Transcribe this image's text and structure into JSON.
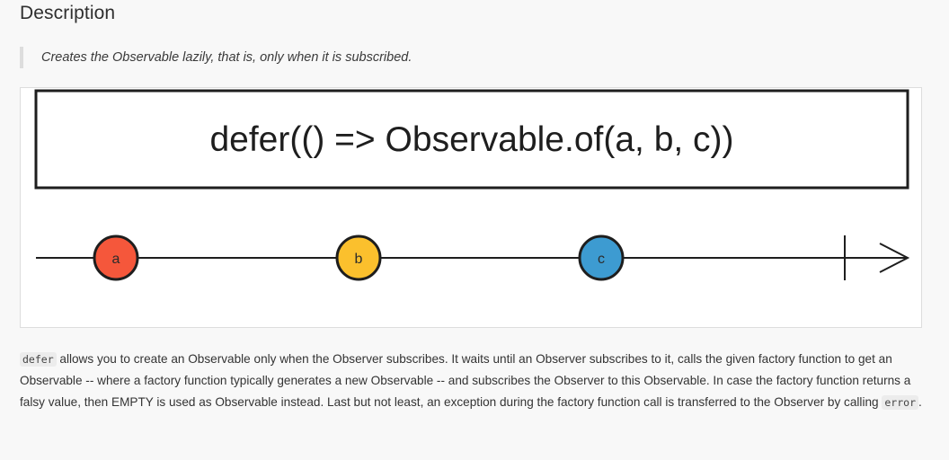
{
  "section": {
    "title": "Description"
  },
  "summary": {
    "text": "Creates the Observable lazily, that is, only when it is subscribed."
  },
  "diagram": {
    "operator_label": "defer(() => Observable.of(a, b, c))",
    "marbles": [
      {
        "label": "a",
        "color": "#f5573b"
      },
      {
        "label": "b",
        "color": "#fbc02d"
      },
      {
        "label": "c",
        "color": "#3d9bd1"
      }
    ],
    "colors": {
      "line": "#1e1e1e",
      "marble_text": "#2b2b2b"
    }
  },
  "description": {
    "code_defer": "defer",
    "text_1": " allows you to create an Observable only when the Observer subscribes. It waits until an Observer subscribes to it, calls the given factory function to get an Observable -- where a factory function typically generates a new Observable -- and subscribes the Observer to this Observable. In case the factory function returns a falsy value, then EMPTY is used as Observable instead. Last but not least, an exception during the factory function call is transferred to the Observer by calling ",
    "code_error": "error",
    "text_2": "."
  }
}
